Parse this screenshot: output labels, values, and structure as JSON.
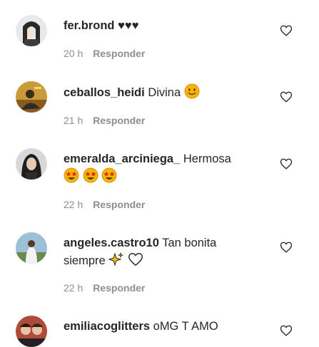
{
  "comments": [
    {
      "username": "fer.brond",
      "text": "♥♥♥",
      "time": "20 h",
      "reply_label": "Responder",
      "like_icon": "heart-outline-icon"
    },
    {
      "username": "ceballos_heidi",
      "text": "Divina",
      "emoji": "smiling-face-icon",
      "time": "21 h",
      "reply_label": "Responder",
      "like_icon": "heart-outline-icon"
    },
    {
      "username": "emeralda_arciniega_",
      "text": "Hermosa",
      "emoji": "star-struck-face-icon x3",
      "time": "22 h",
      "reply_label": "Responder",
      "like_icon": "heart-outline-icon"
    },
    {
      "username": "angeles.castro10",
      "text": "Tan bonita",
      "text2": "siempre",
      "emoji": "sparkles-icon, white-heart-icon",
      "time": "22 h",
      "reply_label": "Responder",
      "like_icon": "heart-outline-icon"
    },
    {
      "username": "emiliacoglitters",
      "text": "oMG T AMO",
      "like_icon": "heart-outline-icon"
    }
  ],
  "colors": {
    "text": "#262626",
    "meta": "#8e8e8e",
    "emoji_yellow": "#f7b500",
    "emoji_red": "#e2231a"
  }
}
